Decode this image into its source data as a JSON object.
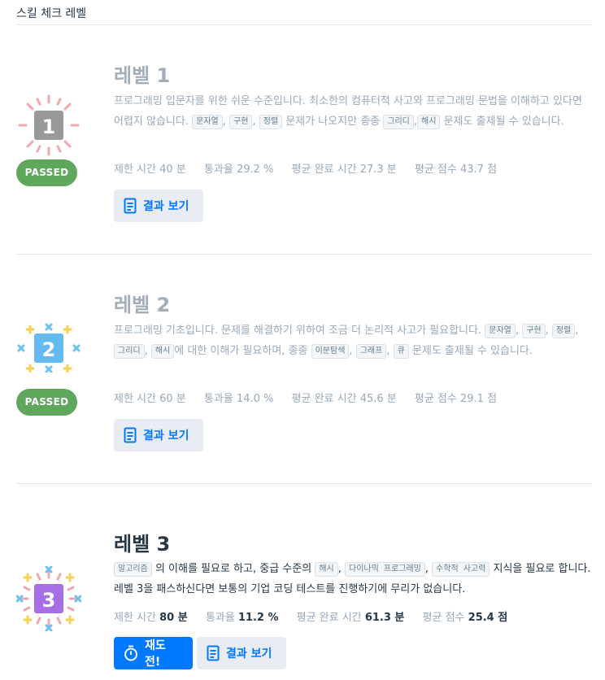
{
  "header": {
    "title": "스킬 체크 레벨"
  },
  "levels": [
    {
      "badge_number": "1",
      "badge_color": "#999999",
      "status": "PASSED",
      "title": "레벨 1",
      "desc": {
        "t1": "프로그래밍 입문자를 위한 쉬운 수준입니다. 최소한의 컴퓨터적 사고와 프로그래밍 문법을 이해하고 있다면 어렵지 않습니다.",
        "tag1": "문자열",
        "tag2": "구현",
        "tag3": "정렬",
        "t2": "문제가 나오지만 종종",
        "tag4": "그리디",
        "tag5": "해시",
        "t3": "문제도 출제될 수 있습니다."
      },
      "stats": {
        "time_label": "제한 시간",
        "time_value": "40 분",
        "rate_label": "통과율",
        "rate_value": "29.2 %",
        "avg_time_label": "평균 완료 시간",
        "avg_time_value": "27.3 분",
        "avg_score_label": "평균 점수",
        "avg_score_value": "43.7 점"
      },
      "result_button": "결과 보기"
    },
    {
      "badge_number": "2",
      "badge_color": "#63b9f0",
      "status": "PASSED",
      "title": "레벨 2",
      "desc": {
        "t1": "프로그래밍 기초입니다. 문제를 해결하기 위하여 조금 더 논리적 사고가 필요합니다.",
        "tag1": "문자열",
        "tag2": "구현",
        "tag3": "정렬",
        "tag4": "그리디",
        "tag5": "해시",
        "t2": "에 대한 이해가 필요하며, 종종",
        "tag6": "이분탐색",
        "tag7": "그래프",
        "tag8": "큐",
        "t3": "문제도 출제될 수 있습니다."
      },
      "stats": {
        "time_label": "제한 시간",
        "time_value": "60 분",
        "rate_label": "통과율",
        "rate_value": "14.0 %",
        "avg_time_label": "평균 완료 시간",
        "avg_time_value": "45.6 분",
        "avg_score_label": "평균 점수",
        "avg_score_value": "29.1 점"
      },
      "result_button": "결과 보기"
    },
    {
      "badge_number": "3",
      "badge_color": "#a86ee6",
      "title": "레벨 3",
      "desc": {
        "tag1": "알고리즘",
        "t1": "의 이해를 필요로 하고, 중급 수준의",
        "tag2": "해시",
        "tag3": "다이나믹 프로그래밍",
        "tag4": "수학적 사고력",
        "t2": "지식을 필요로 합니다. 레벨 3을 패스하신다면 보통의 기업 코딩 테스트를 진행하기에 무리가 없습니다."
      },
      "stats": {
        "time_label": "제한 시간",
        "time_value": "80 분",
        "rate_label": "통과율",
        "rate_value": "11.2 %",
        "avg_time_label": "평균 완료 시간",
        "avg_time_value": "61.3 분",
        "avg_score_label": "평균 점수",
        "avg_score_value": "25.4 점"
      },
      "retry_button": "재도전!",
      "result_button": "결과 보기"
    }
  ],
  "colors": {
    "accent": "#0078ff",
    "passed": "#5fa75c",
    "muted_text": "#98a8b9",
    "spark_pink": "#f3a6ae",
    "spark_blue": "#6fc3ef",
    "spark_yellow": "#f5d254"
  },
  "icons": {
    "result": "document-icon",
    "retry": "stopwatch-icon"
  }
}
